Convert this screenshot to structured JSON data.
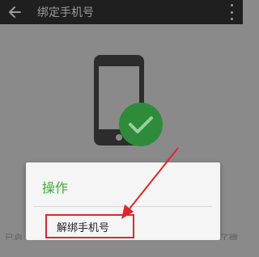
{
  "appbar": {
    "title": "绑定手机号",
    "icons": {
      "back": "back-arrow-icon",
      "more": "more-vertical-icon"
    }
  },
  "content": {
    "illustration": "phone-verified-icon",
    "text_left": "已启",
    "text_right": "了微"
  },
  "dialog": {
    "title": "操作",
    "items": [
      {
        "label": "解绑手机号",
        "highlighted": true
      }
    ]
  },
  "colors": {
    "dialog_title": "#3aaa35",
    "highlight_border": "#e0262a",
    "check_badge": "#2e8b3a"
  }
}
